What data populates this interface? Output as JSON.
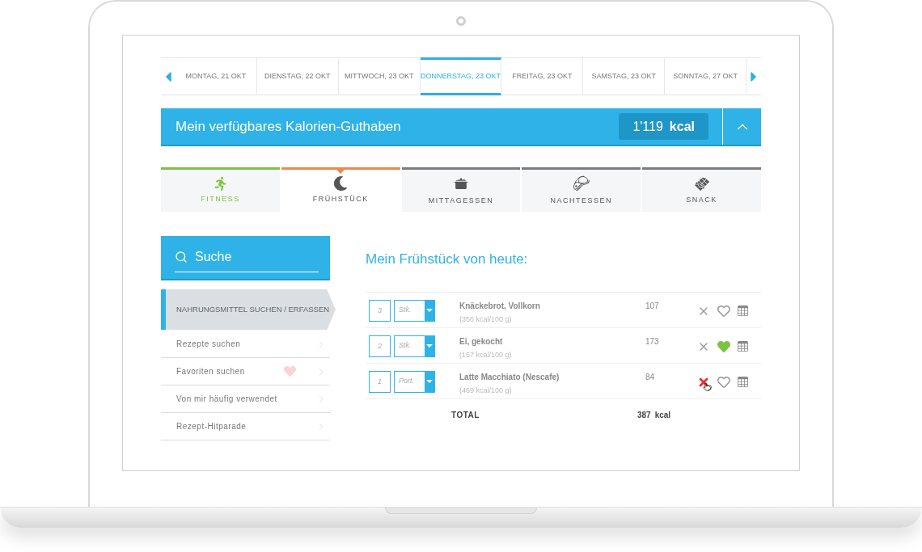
{
  "days": [
    {
      "label": "MONTAG, 21 OKT",
      "selected": false
    },
    {
      "label": "DIENSTAG, 22 OKT",
      "selected": false
    },
    {
      "label": "MITTWOCH, 23 OKT",
      "selected": false
    },
    {
      "label": "DONNERSTAG, 23 OKT",
      "selected": true
    },
    {
      "label": "FREITAG, 23 OKT",
      "selected": false
    },
    {
      "label": "SAMSTAG, 23 OKT",
      "selected": false
    },
    {
      "label": "SONNTAG, 27 OKT",
      "selected": false
    }
  ],
  "balance": {
    "title": "Mein verfügbares Kalorien-Guthaben",
    "value": "1'119",
    "unit": "kcal"
  },
  "meals": [
    {
      "kind": "fitness",
      "label": "FITNESS",
      "color": "#7dc242",
      "selected": false
    },
    {
      "kind": "breakfast",
      "label": "FRÜHSTÜCK",
      "color": "#f0874f",
      "selected": true
    },
    {
      "kind": "lunch",
      "label": "MITTAGESSEN",
      "color": "#7c7c7c",
      "selected": false
    },
    {
      "kind": "dinner",
      "label": "NACHTESSEN",
      "color": "#7c7c7c",
      "selected": false
    },
    {
      "kind": "snack",
      "label": "SNACK",
      "color": "#7c7c7c",
      "selected": false
    }
  ],
  "search": {
    "placeholder": "Suche"
  },
  "menu": [
    {
      "label": "NAHRUNGSMITTEL SUCHEN / ERFASSEN",
      "selected": true
    },
    {
      "label": "Rezepte suchen",
      "selected": false
    },
    {
      "label": "Favoriten suchen",
      "selected": false,
      "heart": true
    },
    {
      "label": "Von mir häufig verwendet",
      "selected": false
    },
    {
      "label": "Rezept-Hitparade",
      "selected": false
    }
  ],
  "heading": "Mein Frühstück von heute:",
  "foods": [
    {
      "qty": "3",
      "unit": "Stk.",
      "name": "Knäckebrot, Vollkorn",
      "info": "(356 kcal/100 g)",
      "kcal": "107",
      "favorite": false,
      "remove_hovered": false
    },
    {
      "qty": "2",
      "unit": "Stk.",
      "name": "Ei, gekocht",
      "info": "(157 kcal/100 g)",
      "kcal": "173",
      "favorite": true,
      "remove_hovered": false
    },
    {
      "qty": "1",
      "unit": "Port.",
      "name": "Latte Macchiato (Nescafe)",
      "info": "(469 kcal/100 g)",
      "kcal": "84",
      "favorite": false,
      "remove_hovered": true
    }
  ],
  "total": {
    "label": "TOTAL",
    "value": "387",
    "unit": "kcal"
  }
}
